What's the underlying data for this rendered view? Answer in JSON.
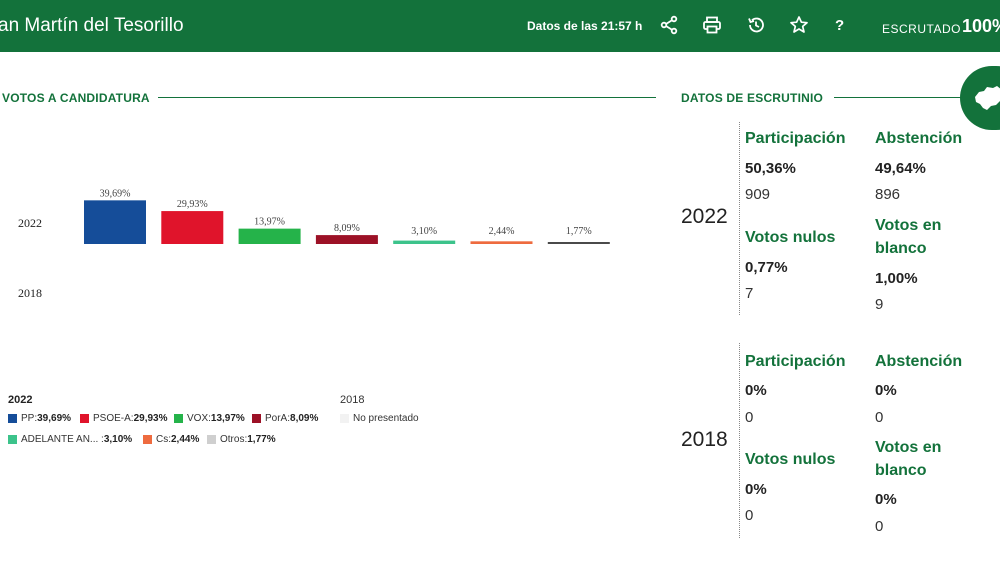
{
  "header": {
    "title": "an Martín del Tesorillo",
    "update": "Datos de las 21:57 h",
    "help": "?",
    "escrutado_label": "ESCRUTADO",
    "escrutado_value": "100%"
  },
  "sections": {
    "votes_title": "VOTOS A CANDIDATURA",
    "scrutiny_title": "DATOS DE ESCRUTINIO"
  },
  "chart_data": {
    "type": "bar",
    "categories": [
      "PP",
      "PSOE-A",
      "VOX",
      "PorA",
      "ADELANTE AN...",
      "Cs",
      "Otros"
    ],
    "series": [
      {
        "name": "2022",
        "values": [
          39.69,
          29.93,
          13.97,
          8.09,
          3.1,
          2.44,
          1.77
        ],
        "labels": [
          "39,69%",
          "29,93%",
          "13,97%",
          "8,09%",
          "3,10%",
          "2,44%",
          "1,77%"
        ]
      },
      {
        "name": "2018",
        "values": []
      }
    ],
    "colors": [
      "#154d99",
      "#e0142b",
      "#25b34a",
      "#9c1126",
      "#3cc38b",
      "#ee6b3f",
      "#4a4a4a"
    ],
    "ylim": [
      0,
      40
    ]
  },
  "legend": {
    "year_2022": "2022",
    "year_2018": "2018",
    "items_2022": [
      {
        "name": "PP:",
        "value": "39,69%"
      },
      {
        "name": "PSOE-A:",
        "value": "29,93%"
      },
      {
        "name": "VOX:",
        "value": "13,97%"
      },
      {
        "name": "PorA:",
        "value": "8,09%"
      },
      {
        "name": "ADELANTE AN... :",
        "value": "3,10%"
      },
      {
        "name": "Cs:",
        "value": "2,44%"
      },
      {
        "name": "Otros:",
        "value": "1,77%"
      }
    ],
    "item_2018": "No presentado"
  },
  "scrutiny": [
    {
      "year": "2022",
      "participacion_label": "Participación",
      "participacion_pct": "50,36%",
      "participacion_num": "909",
      "abstencion_label": "Abstención",
      "abstencion_pct": "49,64%",
      "abstencion_num": "896",
      "nulos_label": "Votos nulos",
      "nulos_pct": "0,77%",
      "nulos_num": "7",
      "blanco_label_1": "Votos en",
      "blanco_label_2": "blanco",
      "blanco_pct": "1,00%",
      "blanco_num": "9"
    },
    {
      "year": "2018",
      "participacion_label": "Participación",
      "participacion_pct": "0%",
      "participacion_num": "0",
      "abstencion_label": "Abstención",
      "abstencion_pct": "0%",
      "abstencion_num": "0",
      "nulos_label": "Votos nulos",
      "nulos_pct": "0%",
      "nulos_num": "0",
      "blanco_label_1": "Votos en",
      "blanco_label_2": "blanco",
      "blanco_pct": "0%",
      "blanco_num": "0"
    }
  ],
  "icons": [
    "share-icon",
    "print-icon",
    "history-icon",
    "star-icon",
    "andalusia-map-icon"
  ]
}
